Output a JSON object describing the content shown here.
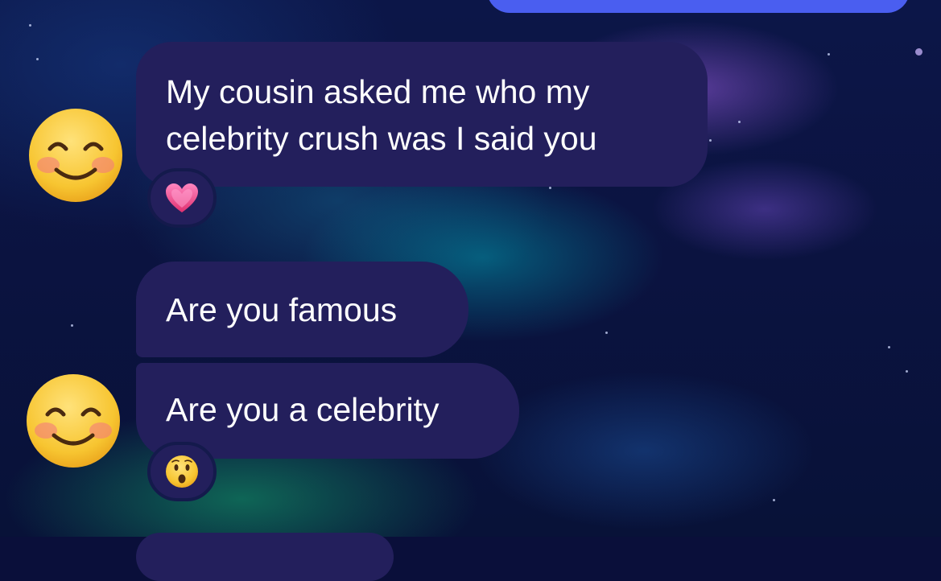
{
  "conversation": {
    "messages": [
      {
        "text_line1": "My cousin asked me who my",
        "text_line2": "celebrity crush was I said you",
        "reaction": "heart-icon",
        "sender_avatar": "smiling-face-icon"
      },
      {
        "text": "Are you famous"
      },
      {
        "text": "Are you a celebrity",
        "reaction": "hushed-face-icon",
        "sender_avatar": "smiling-face-icon"
      }
    ]
  },
  "colors": {
    "received_bubble": "#231f5c",
    "sent_bubble": "#4a5ef0",
    "reaction_heart": "#f45ba0",
    "emoji_face": "#f7c531"
  }
}
